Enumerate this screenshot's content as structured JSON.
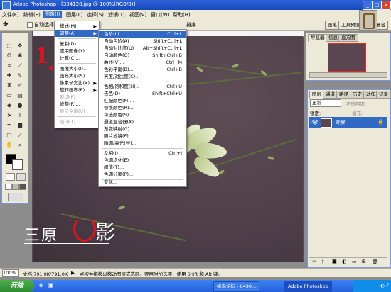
{
  "window": {
    "title": "Adobe Photoshop - [334128.jpg @ 100%(RGB/8)]"
  },
  "menubar": {
    "items": [
      "文件(F)",
      "编辑(E)",
      "图像(I)",
      "图层(L)",
      "选择(S)",
      "滤镜(T)",
      "视图(V)",
      "窗口(W)",
      "帮助(H)"
    ],
    "active": "图像(I)"
  },
  "options": {
    "auto_select_label": "自动选择",
    "tail_label": "排序"
  },
  "workspace_tabs": [
    "画笔",
    "工具预设",
    "图层复合"
  ],
  "image_menu": {
    "items": [
      {
        "label": "模式(M)",
        "submenu": true,
        "disabled": false
      },
      {
        "label": "调整(A)",
        "submenu": true,
        "disabled": false,
        "selected": true
      },
      {
        "label": "复制(D)...",
        "disabled": false
      },
      {
        "label": "应用图像(Y)...",
        "disabled": false
      },
      {
        "label": "计算(C)...",
        "disabled": false
      },
      {
        "label": "图像大小(I)...",
        "disabled": false
      },
      {
        "label": "画布大小(S)...",
        "disabled": false
      },
      {
        "label": "像素长宽比(X)",
        "submenu": true,
        "disabled": false
      },
      {
        "label": "旋转画布(E)",
        "submenu": true,
        "disabled": false
      },
      {
        "label": "裁切(P)",
        "disabled": true
      },
      {
        "label": "修整(R)...",
        "disabled": false
      },
      {
        "label": "显示全部(V)",
        "disabled": true
      },
      {
        "label": "陷印(T)...",
        "disabled": true
      }
    ]
  },
  "adjust_menu": {
    "items": [
      {
        "label": "色阶(L)...",
        "shortcut": "Ctrl+L"
      },
      {
        "label": "自动色阶(A)",
        "shortcut": "Shift+Ctrl+L"
      },
      {
        "label": "自动对比度(U)",
        "shortcut": "Alt+Shift+Ctrl+L"
      },
      {
        "label": "自动颜色(O)",
        "shortcut": "Shift+Ctrl+B"
      },
      {
        "label": "曲线(V)...",
        "shortcut": "Ctrl+M"
      },
      {
        "label": "色彩平衡(B)...",
        "shortcut": "Ctrl+B"
      },
      {
        "label": "亮度/对比度(C)...",
        "shortcut": ""
      },
      {
        "label": "色相/饱和度(H)...",
        "shortcut": "Ctrl+U"
      },
      {
        "label": "去色(D)",
        "shortcut": "Shift+Ctrl+U"
      },
      {
        "label": "匹配颜色(M)...",
        "shortcut": ""
      },
      {
        "label": "替换颜色(R)...",
        "shortcut": ""
      },
      {
        "label": "可选颜色(S)...",
        "shortcut": ""
      },
      {
        "label": "通道混合器(X)...",
        "shortcut": ""
      },
      {
        "label": "渐变映射(G)...",
        "shortcut": ""
      },
      {
        "label": "照片滤镜(F)...",
        "shortcut": ""
      },
      {
        "label": "暗调/高光(W)...",
        "shortcut": ""
      },
      {
        "label": "反相(I)",
        "shortcut": "Ctrl+I"
      },
      {
        "label": "色调均化(E)",
        "shortcut": ""
      },
      {
        "label": "阈值(T)...",
        "shortcut": ""
      },
      {
        "label": "色调分离(P)...",
        "shortcut": ""
      },
      {
        "label": "变化...",
        "shortcut": ""
      }
    ]
  },
  "navigator_panel": {
    "tabs": [
      "导航器",
      "信息",
      "直方图"
    ]
  },
  "layers_panel": {
    "tabs": [
      "图层",
      "通道",
      "路径",
      "历史",
      "动作",
      "记录"
    ],
    "blend_mode": "正常",
    "opacity_label": "不透明度:",
    "lock_label": "锁定:",
    "fill_label": "填充:",
    "layer_name": "背景"
  },
  "status": {
    "zoom": "100%",
    "doc_info": "文档:791.0K/791.0K",
    "hint": "点按并拖移以移动图层或选区。要用附加选项，使用 Shift 和 Alt 键。"
  },
  "taskbar": {
    "start_label": "开始",
    "tasks": [
      "蜂鸟论坛 - 6490...",
      "Adobe Photoshop"
    ],
    "clock": ""
  },
  "watermark": {
    "text1": "三原",
    "text2": "影",
    "step_number": "1"
  }
}
